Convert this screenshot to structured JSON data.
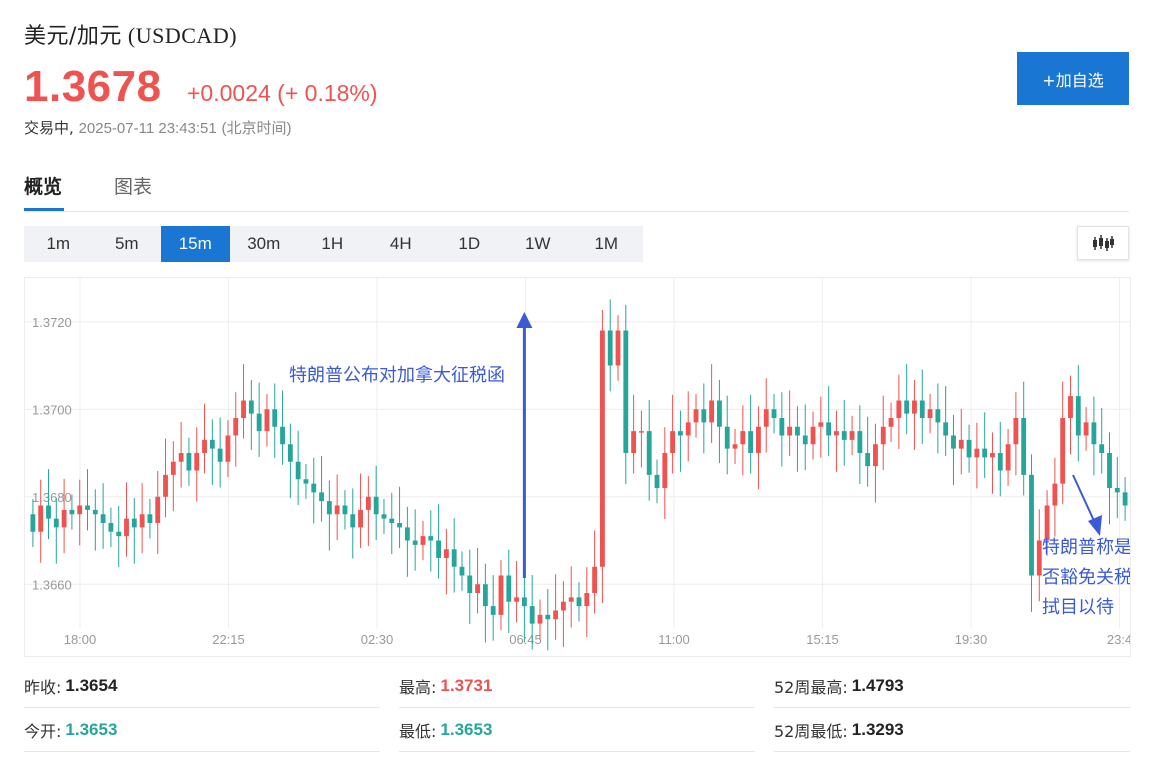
{
  "header": {
    "title_cn": "美元/加元",
    "title_code": "(USDCAD)",
    "price": "1.3678",
    "change": "+0.0024 (+ 0.18%)",
    "status_prefix": "交易中,",
    "timestamp": "2025-07-11 23:43:51",
    "timezone": "(北京时间)",
    "watch_button": "+加自选"
  },
  "tabs": [
    {
      "label": "概览",
      "active": true
    },
    {
      "label": "图表",
      "active": false
    }
  ],
  "periods": [
    "1m",
    "5m",
    "15m",
    "30m",
    "1H",
    "4H",
    "1D",
    "1W",
    "1M"
  ],
  "active_period": "15m",
  "chart_data": {
    "type": "candlestick",
    "title": "",
    "x_ticks": [
      "18:00",
      "22:15",
      "02:30",
      "06:45",
      "11:00",
      "15:15",
      "19:30",
      "23:4"
    ],
    "y_ticks": [
      "1.3720",
      "1.3700",
      "1.3680",
      "1.3660"
    ],
    "ylim": [
      1.365,
      1.373
    ],
    "grid": true,
    "colors": {
      "up": "#ef5350",
      "down": "#26a69a",
      "arrow": "#3b5bd6",
      "annotation": "#3b5bd6"
    },
    "annotations": [
      {
        "text": "特朗普公布对加拿大征税函",
        "at_index": 63,
        "arrow": "up"
      },
      {
        "text": "特朗普称是否豁免关税拭目以待",
        "lines": [
          "特朗普称是",
          "否豁免关税",
          "拭目以待"
        ],
        "at_index": 126,
        "arrow": "down-right"
      }
    ],
    "closes": [
      1.3672,
      1.3678,
      1.3675,
      1.3673,
      1.3677,
      1.3676,
      1.3678,
      1.3677,
      1.3676,
      1.3674,
      1.3672,
      1.3671,
      1.3675,
      1.3673,
      1.3676,
      1.3674,
      1.368,
      1.3685,
      1.3688,
      1.369,
      1.3686,
      1.369,
      1.3693,
      1.3691,
      1.3688,
      1.3694,
      1.3698,
      1.3702,
      1.3699,
      1.3695,
      1.37,
      1.3696,
      1.3692,
      1.3688,
      1.3684,
      1.3683,
      1.3681,
      1.3679,
      1.3676,
      1.3678,
      1.3676,
      1.3673,
      1.3677,
      1.368,
      1.3676,
      1.3675,
      1.3674,
      1.3673,
      1.367,
      1.3669,
      1.3671,
      1.367,
      1.3666,
      1.3668,
      1.3664,
      1.3662,
      1.3658,
      1.366,
      1.3655,
      1.3653,
      1.3662,
      1.3656,
      1.3657,
      1.3655,
      1.3651,
      1.3653,
      1.3652,
      1.3654,
      1.3656,
      1.3657,
      1.3655,
      1.3658,
      1.3664,
      1.3718,
      1.371,
      1.3718,
      1.369,
      1.3695,
      1.3695,
      1.3685,
      1.3682,
      1.369,
      1.3695,
      1.3694,
      1.3697,
      1.37,
      1.3697,
      1.3702,
      1.3696,
      1.3691,
      1.3692,
      1.3695,
      1.369,
      1.3696,
      1.37,
      1.3698,
      1.3694,
      1.3696,
      1.3694,
      1.3692,
      1.3696,
      1.3697,
      1.3694,
      1.3695,
      1.3693,
      1.3695,
      1.369,
      1.3687,
      1.3692,
      1.3696,
      1.3698,
      1.3702,
      1.3699,
      1.3702,
      1.3698,
      1.37,
      1.3697,
      1.3694,
      1.3691,
      1.3693,
      1.3689,
      1.3691,
      1.3689,
      1.369,
      1.3686,
      1.3692,
      1.3698,
      1.3685,
      1.3662,
      1.367,
      1.3678,
      1.3683,
      1.3698,
      1.3703,
      1.3694,
      1.3697,
      1.3692,
      1.369,
      1.3682,
      1.3681,
      1.3678
    ]
  },
  "stats": [
    {
      "label": "昨收:",
      "value": "1.3654",
      "tone": "dark"
    },
    {
      "label": "最高:",
      "value": "1.3731",
      "tone": "red"
    },
    {
      "label": "52周最高:",
      "value": "1.4793",
      "tone": "dark"
    },
    {
      "label": "今开:",
      "value": "1.3653",
      "tone": "green"
    },
    {
      "label": "最低:",
      "value": "1.3653",
      "tone": "green"
    },
    {
      "label": "52周最低:",
      "value": "1.3293",
      "tone": "dark"
    }
  ]
}
